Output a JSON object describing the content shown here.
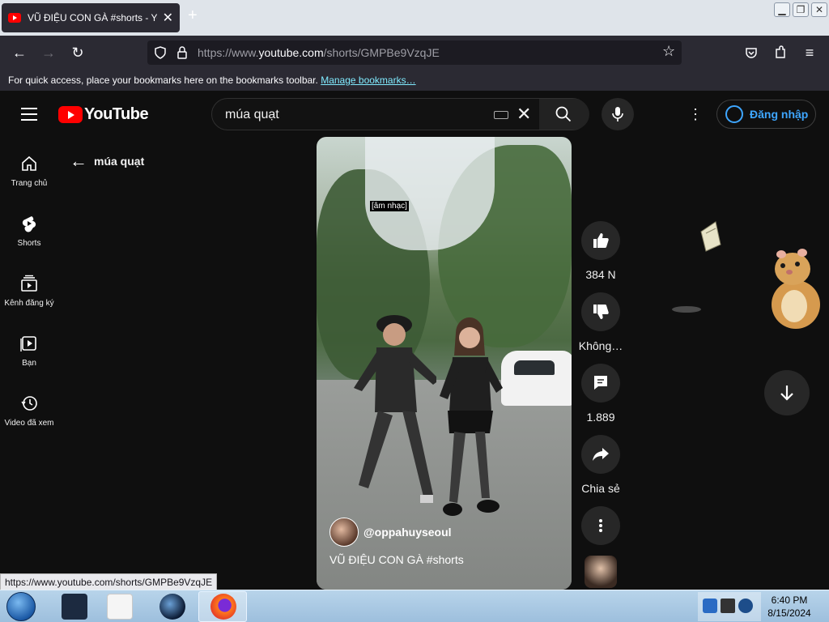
{
  "browser": {
    "tab_title": "VŨ ĐIỆU CON GÀ #shorts - YouTube",
    "new_tab": "+",
    "url_prefix": "https://www.",
    "url_domain": "youtube.com",
    "url_path": "/shorts/GMPBe9VzqJE",
    "bookmarks_text": "For quick access, place your bookmarks here on the bookmarks toolbar.",
    "bookmarks_link": "Manage bookmarks…"
  },
  "youtube": {
    "logo_text": "YouTube",
    "search_query": "múa quạt",
    "signin_label": "Đăng nhập",
    "back_label": "múa quạt",
    "rail": [
      {
        "label": "Trang chủ",
        "icon": "home-icon"
      },
      {
        "label": "Shorts",
        "icon": "shorts-icon"
      },
      {
        "label": "Kênh đăng ký",
        "icon": "subscriptions-icon"
      },
      {
        "label": "Bạn",
        "icon": "you-icon"
      },
      {
        "label": "Video đã xem",
        "icon": "history-icon"
      }
    ],
    "video": {
      "caption_tag": "[âm nhạc]",
      "channel": "@oppahuyseoul",
      "title": "VŨ ĐIỆU CON GÀ #shorts"
    },
    "actions": {
      "likes": "384 N",
      "dislike": "Không…",
      "comments": "1.889",
      "share": "Chia sẻ"
    }
  },
  "status_url": "https://www.youtube.com/shorts/GMPBe9VzqJE",
  "taskbar": {
    "time": "6:40 PM",
    "date": "8/15/2024"
  },
  "colors": {
    "youtube_red": "#ff0000",
    "link_blue": "#3ea6ff",
    "page_bg": "#0f0f0f"
  }
}
